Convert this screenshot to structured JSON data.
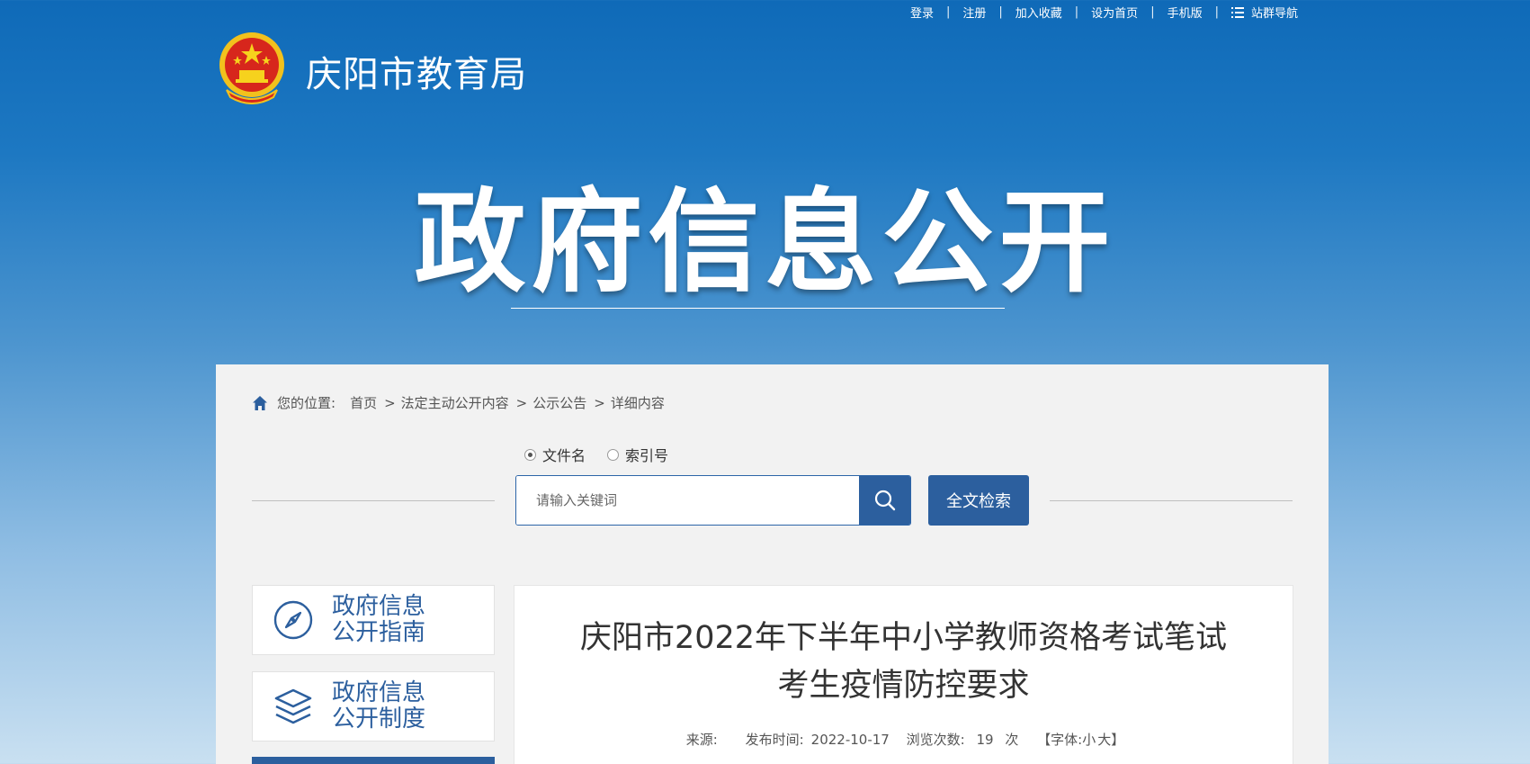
{
  "top_links": {
    "login": "登录",
    "register": "注册",
    "favorite": "加入收藏",
    "homepage": "设为首页",
    "mobile": "手机版",
    "site_nav": "站群导航",
    "separator": "|"
  },
  "header": {
    "site_name": "庆阳市教育局",
    "logo_icon": "national-emblem-icon"
  },
  "banner": {
    "title": "政府信息公开"
  },
  "breadcrumb": {
    "label": "您的位置:",
    "items": [
      "首页",
      "法定主动公开内容",
      "公示公告",
      "详细内容"
    ],
    "separator": ">"
  },
  "search": {
    "options": [
      "文件名",
      "索引号"
    ],
    "selected": "文件名",
    "placeholder": "请输入关键词",
    "value": "",
    "full_text_button": "全文检索"
  },
  "sidebar": {
    "items": [
      {
        "label": "政府信息公开指南",
        "icon": "compass-icon"
      },
      {
        "label": "政府信息公开制度",
        "icon": "layers-icon"
      }
    ]
  },
  "article": {
    "title": "庆阳市2022年下半年中小学教师资格考试笔试考生疫情防控要求",
    "source_label": "来源:",
    "source": "",
    "date_label": "发布时间:",
    "date": "2022-10-17",
    "views_label": "浏览次数:",
    "views": "19",
    "views_unit": "次",
    "font_label": "【字体:",
    "font_small": "小",
    "font_large": "大",
    "font_close": "】"
  },
  "colors": {
    "primary": "#2c5f9e",
    "header_bg": "#0f6ab8",
    "panel_bg": "#f2f2f2"
  }
}
